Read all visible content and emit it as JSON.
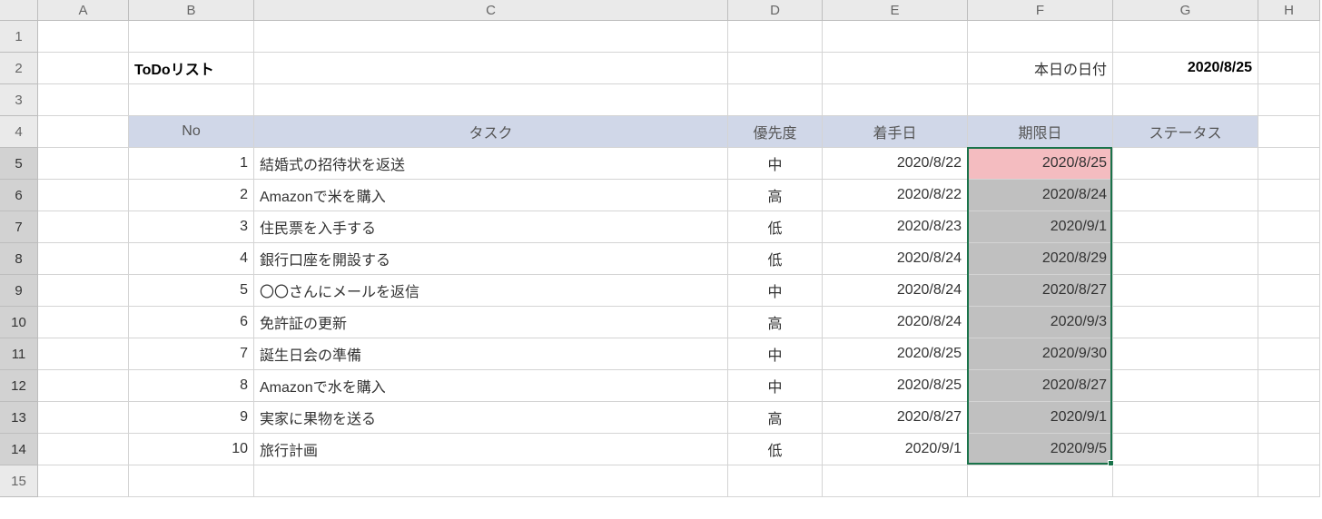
{
  "columns": [
    "A",
    "B",
    "C",
    "D",
    "E",
    "F",
    "G",
    "H"
  ],
  "row_numbers": [
    "1",
    "2",
    "3",
    "4",
    "5",
    "6",
    "7",
    "8",
    "9",
    "10",
    "11",
    "12",
    "13",
    "14",
    "15"
  ],
  "title": "ToDoリスト",
  "today_label": "本日の日付",
  "today_value": "2020/8/25",
  "headers": {
    "no": "No",
    "task": "タスク",
    "priority": "優先度",
    "start": "着手日",
    "deadline": "期限日",
    "status": "ステータス"
  },
  "rows": [
    {
      "no": "1",
      "task": "結婚式の招待状を返送",
      "priority": "中",
      "start": "2020/8/22",
      "deadline": "2020/8/25",
      "highlight": true
    },
    {
      "no": "2",
      "task": "Amazonで米を購入",
      "priority": "高",
      "start": "2020/8/22",
      "deadline": "2020/8/24",
      "highlight": false
    },
    {
      "no": "3",
      "task": "住民票を入手する",
      "priority": "低",
      "start": "2020/8/23",
      "deadline": "2020/9/1",
      "highlight": false
    },
    {
      "no": "4",
      "task": "銀行口座を開設する",
      "priority": "低",
      "start": "2020/8/24",
      "deadline": "2020/8/29",
      "highlight": false
    },
    {
      "no": "5",
      "task": "〇〇さんにメールを返信",
      "priority": "中",
      "start": "2020/8/24",
      "deadline": "2020/8/27",
      "highlight": false
    },
    {
      "no": "6",
      "task": "免許証の更新",
      "priority": "高",
      "start": "2020/8/24",
      "deadline": "2020/9/3",
      "highlight": false
    },
    {
      "no": "7",
      "task": "誕生日会の準備",
      "priority": "中",
      "start": "2020/8/25",
      "deadline": "2020/9/30",
      "highlight": false
    },
    {
      "no": "8",
      "task": "Amazonで水を購入",
      "priority": "中",
      "start": "2020/8/25",
      "deadline": "2020/8/27",
      "highlight": false
    },
    {
      "no": "9",
      "task": "実家に果物を送る",
      "priority": "高",
      "start": "2020/8/27",
      "deadline": "2020/9/1",
      "highlight": false
    },
    {
      "no": "10",
      "task": "旅行計画",
      "priority": "低",
      "start": "2020/9/1",
      "deadline": "2020/9/5",
      "highlight": false
    }
  ]
}
